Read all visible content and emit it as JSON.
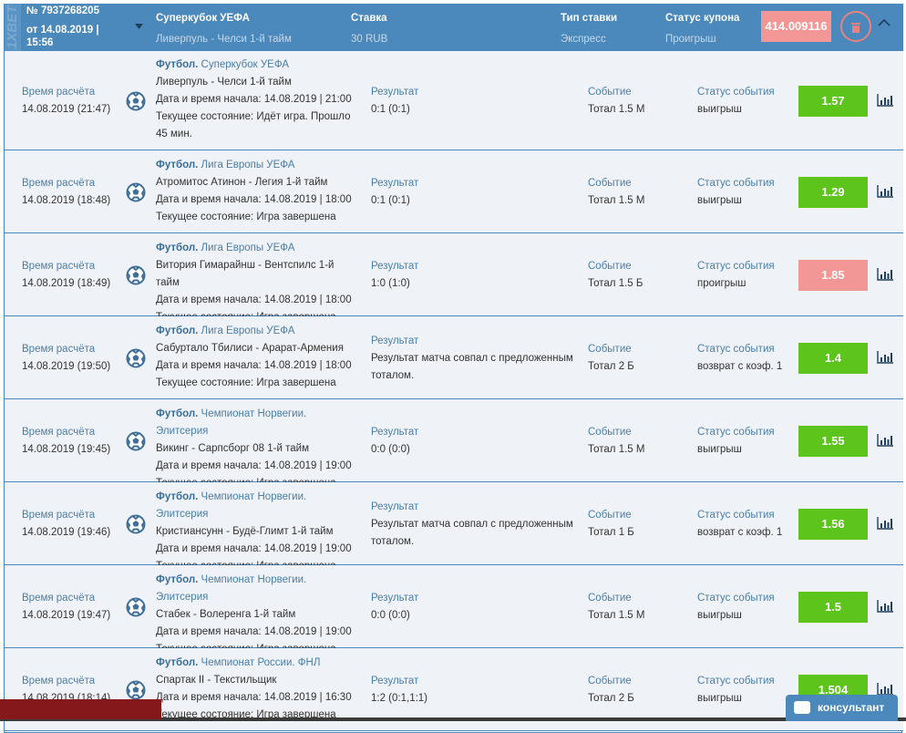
{
  "header": {
    "logo": "1XBET",
    "coupon_no": "№ 7937268205",
    "date": "от 14.08.2019 | 15:56",
    "tournament": "Суперкубок УЕФА",
    "match": "Ливерпуль - Челси 1-й тайм",
    "stake_label": "Ставка",
    "stake": "30 RUB",
    "bet_type_label": "Тип ставки",
    "bet_type": "Экспресс",
    "coupon_status_label": "Статус купона",
    "coupon_status": "Проигрыш",
    "total_coef": "414.009116"
  },
  "labels": {
    "settle": "Время расчёта",
    "result": "Результат",
    "event": "Событие",
    "event_status": "Статус события",
    "start": "Дата и время начала: ",
    "state": "Текущее состояние: "
  },
  "colors": {
    "win": "#5cc41a",
    "loss": "#f39796",
    "header": "#4b88bb"
  },
  "rows": [
    {
      "settle": "14.08.2019 (21:47)",
      "sport": "Футбол.",
      "league": "Суперкубок УЕФА",
      "match": "Ливерпуль - Челси 1-й тайм",
      "start": "14.08.2019 | 21:00",
      "state": "Идёт игра. Прошло 45 мин.",
      "result": "0:1 (0:1)",
      "event": "Тотал 1.5 М",
      "status": "выигрыш",
      "odd": "1.57",
      "win": true
    },
    {
      "settle": "14.08.2019 (18:48)",
      "sport": "Футбол.",
      "league": "Лига Европы УЕФА",
      "match": "Атромитос Атинон - Легия 1-й тайм",
      "start": "14.08.2019 | 18:00",
      "state": "Игра завершена",
      "result": "0:1 (0:1)",
      "event": "Тотал 1.5 М",
      "status": "выигрыш",
      "odd": "1.29",
      "win": true
    },
    {
      "settle": "14.08.2019 (18:49)",
      "sport": "Футбол.",
      "league": "Лига Европы УЕФА",
      "match": "Витория Гимарайнш - Вентспилс 1-й тайм",
      "start": "14.08.2019 | 18:00",
      "state": "Игра завершена",
      "result": "1:0 (1:0)",
      "event": "Тотал 1.5 Б",
      "status": "проигрыш",
      "odd": "1.85",
      "win": false
    },
    {
      "settle": "14.08.2019 (19:50)",
      "sport": "Футбол.",
      "league": "Лига Европы УЕФА",
      "match": "Сабуртало Тбилиси - Арарат-Армения",
      "start": "14.08.2019 | 18:00",
      "state": "Игра завершена",
      "result": "Результат матча совпал с предложенным тоталом.",
      "event": "Тотал 2 Б",
      "status": "возврат с коэф. 1",
      "odd": "1.4",
      "win": true
    },
    {
      "settle": "14.08.2019 (19:45)",
      "sport": "Футбол.",
      "league": "Чемпионат Норвегии. Элитсерия",
      "match": "Викинг - Сарпсборг 08 1-й тайм",
      "start": "14.08.2019 | 19:00",
      "state": "Игра завершена",
      "result": "0:0 (0:0)",
      "event": "Тотал 1.5 М",
      "status": "выигрыш",
      "odd": "1.55",
      "win": true
    },
    {
      "settle": "14.08.2019 (19:46)",
      "sport": "Футбол.",
      "league": "Чемпионат Норвегии. Элитсерия",
      "match": "Кристиансунн - Будё-Глимт 1-й тайм",
      "start": "14.08.2019 | 19:00",
      "state": "Игра завершена",
      "result": "Результат матча совпал с предложенным тоталом.",
      "event": "Тотал 1 Б",
      "status": "возврат с коэф. 1",
      "odd": "1.56",
      "win": true
    },
    {
      "settle": "14.08.2019 (19:47)",
      "sport": "Футбол.",
      "league": "Чемпионат Норвегии. Элитсерия",
      "match": "Стабек - Волеренга 1-й тайм",
      "start": "14.08.2019 | 19:00",
      "state": "Игра завершена",
      "result": "0:0 (0:0)",
      "event": "Тотал 1.5 М",
      "status": "выигрыш",
      "odd": "1.5",
      "win": true
    },
    {
      "settle": "14.08.2019 (18:14)",
      "sport": "Футбол.",
      "league": "Чемпионат России. ФНЛ",
      "match": "Спартак II - Текстильщик",
      "start": "14.08.2019 | 16:30",
      "state": "Игра завершена",
      "result": "1:2 (0:1,1:1)",
      "event": "Тотал 2 Б",
      "status": "выигрыш",
      "odd": "1.504",
      "win": true
    }
  ],
  "consultant": "консультант"
}
